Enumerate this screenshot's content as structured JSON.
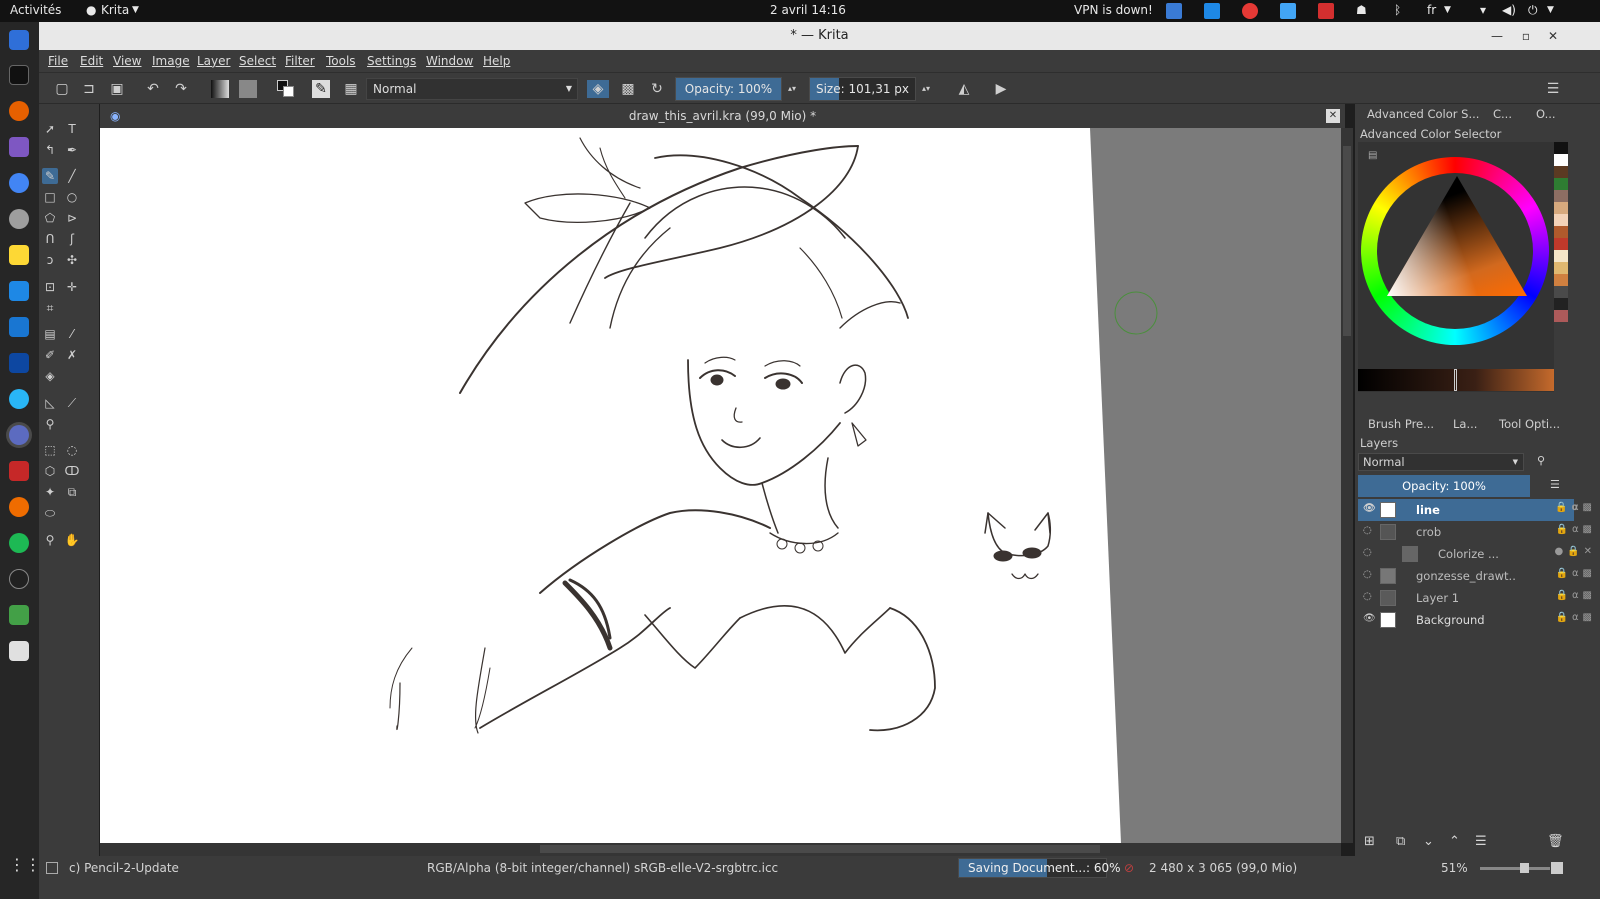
{
  "topbar": {
    "activities": "Activités",
    "app_name": "Krita",
    "clock": "2 avril  14:16",
    "vpn_status": "VPN is down!",
    "keyboard_layout": "fr"
  },
  "window": {
    "title": "* — Krita"
  },
  "menu": {
    "file": "File",
    "edit": "Edit",
    "view": "View",
    "image": "Image",
    "layer": "Layer",
    "select": "Select",
    "filter": "Filter",
    "tools": "Tools",
    "settings": "Settings",
    "window": "Window",
    "help": "Help"
  },
  "toolbar": {
    "blend_mode": "Normal",
    "opacity_label": "Opacity: 100%",
    "opacity_value": 100,
    "size_label": "Size: 101,31 px",
    "size_fill": 0.28
  },
  "document": {
    "tab_title": "draw_this_avril.kra (99,0 Mio) *"
  },
  "docker": {
    "tabs": {
      "color_selector": "Advanced Color S...",
      "c": "C...",
      "o": "O..."
    },
    "color_panel_title": "Advanced Color Selector",
    "lower_tabs": {
      "brush_presets": "Brush Pre...",
      "layers": "La...",
      "tool_options": "Tool Opti..."
    },
    "layers_title": "Layers",
    "layers_blend": "Normal",
    "layers_opacity": "Opacity:  100%",
    "layers": [
      {
        "name": "line",
        "selected": true,
        "visible": true
      },
      {
        "name": "crob",
        "selected": false,
        "visible": false
      },
      {
        "name": "Colorize ...",
        "selected": false,
        "visible": false
      },
      {
        "name": "gonzesse_drawt...",
        "selected": false,
        "visible": false
      },
      {
        "name": "Layer 1",
        "selected": false,
        "visible": false
      },
      {
        "name": "Background",
        "selected": false,
        "visible": true
      }
    ]
  },
  "status": {
    "brush": "c) Pencil-2-Update",
    "color_model": "RGB/Alpha (8-bit integer/channel)  sRGB-elle-V2-srgbtrc.icc",
    "saving_label": "Saving Document...: 60%",
    "saving_progress": 0.6,
    "image_size": "2 480 x 3 065 (99,0 Mio)",
    "zoom": "51%"
  },
  "colors": {
    "accent": "#3e6b95",
    "panel": "#3b3b3b",
    "canvas_bg": "#7b7b7b",
    "ink": "#3a3330"
  }
}
